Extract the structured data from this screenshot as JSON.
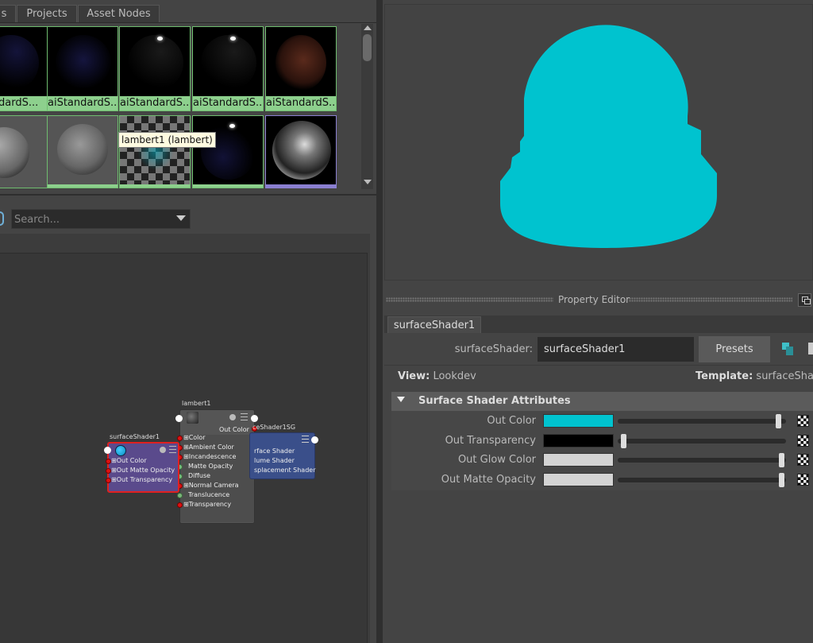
{
  "tabs": [
    "s",
    "Projects",
    "Asset Nodes"
  ],
  "swatches_row1": [
    "ndardS...",
    "aiStandardS...",
    "aiStandardS...",
    "aiStandardS...",
    "aiStandardS..."
  ],
  "tooltip": "lambert1 (lambert)",
  "search": {
    "placeholder": "Search..."
  },
  "nodes": {
    "surface_shader": {
      "title": "surfaceShader1",
      "ports": [
        "Out Color",
        "Out Matte Opacity",
        "Out Transparency"
      ]
    },
    "lambert": {
      "title": "lambert1",
      "header_port": "Out Color",
      "ports": [
        "Color",
        "Ambient Color",
        "Incandescence",
        "Matte Opacity",
        "Diffuse",
        "Normal Camera",
        "Translucence",
        "Transparency"
      ]
    },
    "shading_group": {
      "title": "ceShader1SG",
      "ports": [
        "rface Shader",
        "lume Shader",
        "splacement Shader"
      ]
    }
  },
  "property_editor": {
    "title": "Property Editor",
    "tab": "surfaceShader1",
    "node_type_label": "surfaceShader:",
    "node_name": "surfaceShader1",
    "presets_label": "Presets",
    "view_label": "View:",
    "view_value": "Lookdev",
    "template_label": "Template:",
    "template_value": "surfaceShade",
    "section_title": "Surface Shader Attributes",
    "attributes": [
      {
        "label": "Out Color",
        "color": "#00c3cf",
        "slider": 0.97
      },
      {
        "label": "Out Transparency",
        "color": "#000000",
        "slider": 0.02
      },
      {
        "label": "Out Glow Color",
        "color": "#d4d4d4",
        "slider": 0.99
      },
      {
        "label": "Out Matte Opacity",
        "color": "#d4d4d4",
        "slider": 0.99
      }
    ]
  },
  "colors": {
    "preview_shader": "#00c3cf",
    "selected_node_border": "#e02020",
    "lambert_node": "#555555",
    "sg_node": "#3a4f8a",
    "surface_node": "#5a4a8c"
  }
}
